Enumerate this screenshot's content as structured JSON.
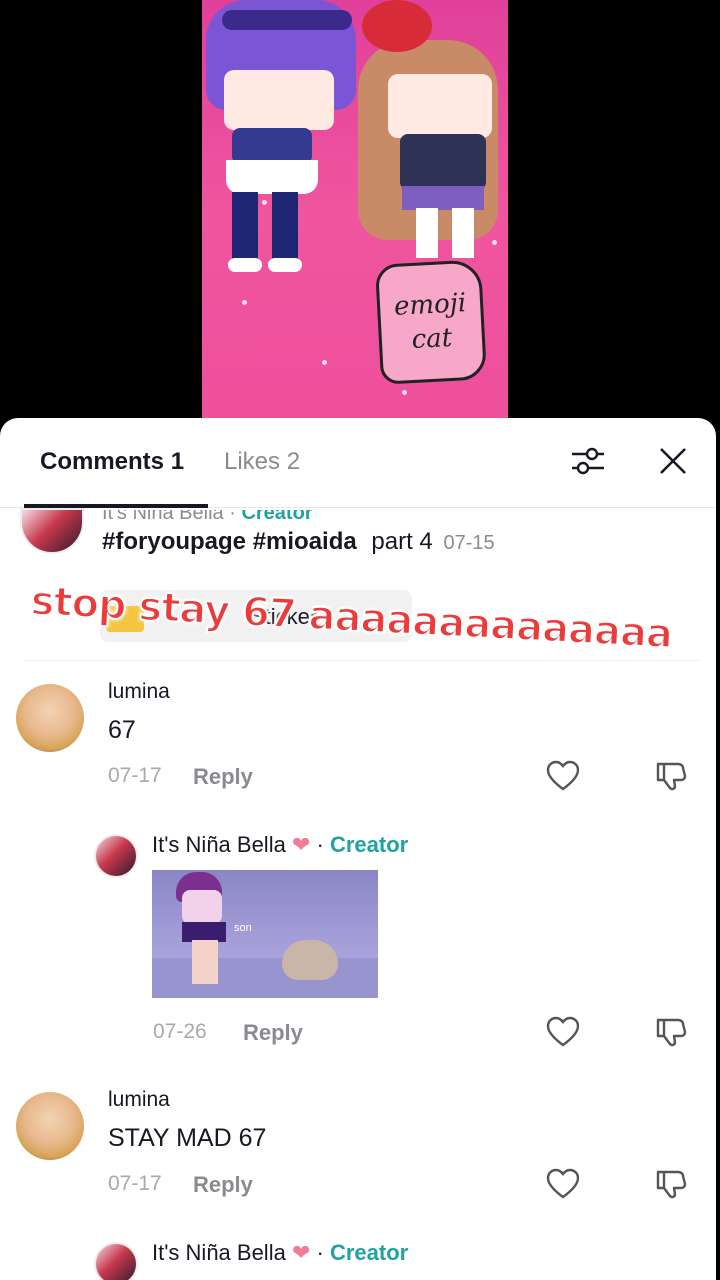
{
  "video": {
    "sticker_line1": "emoji",
    "sticker_line2": "cat"
  },
  "overlay": {
    "text": "stop stay 67 aaaaaaaaaaaaaa"
  },
  "header": {
    "comments_tab": "Comments 1",
    "likes_tab": "Likes 2"
  },
  "caption": {
    "author": "It's Niña Bella",
    "role": "Creator",
    "tags": "#foryoupage #mioaida",
    "text": "part 4",
    "date": "07-15",
    "sticker_label": "Sticker"
  },
  "comments": [
    {
      "user": "lumina",
      "text": "67",
      "date": "07-17",
      "reply_label": "Reply"
    },
    {
      "user": "It's Niña Bella",
      "role": "Creator",
      "gif_caption": "son",
      "date": "07-26",
      "reply_label": "Reply"
    },
    {
      "user": "lumina",
      "text": "STAY MAD 67",
      "date": "07-17",
      "reply_label": "Reply"
    },
    {
      "user": "It's Niña Bella",
      "role": "Creator"
    }
  ],
  "separator": "·",
  "colors": {
    "creator": "#20a39e",
    "overlay": "#ec3b3b",
    "video_bg": "#ee4f9c"
  }
}
